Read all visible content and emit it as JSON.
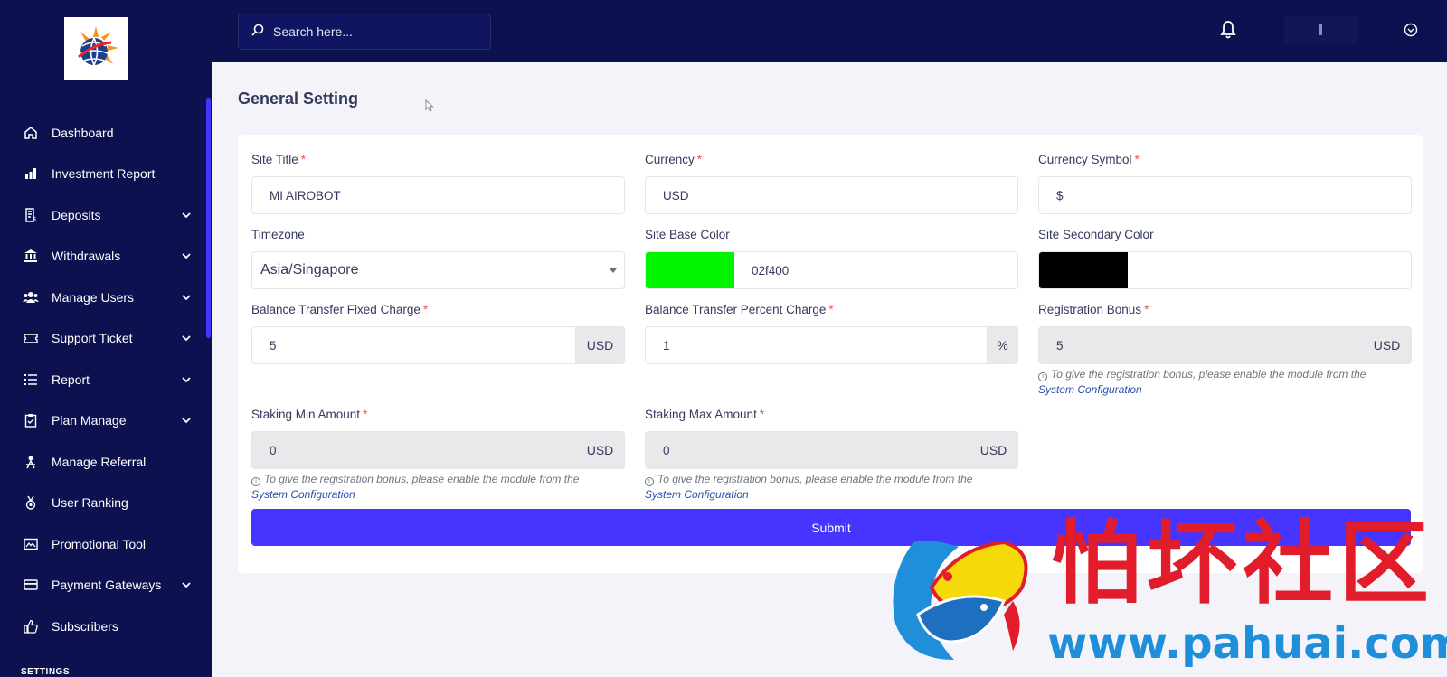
{
  "colors": {
    "sidebar_bg": "#0d1150",
    "accent": "#4634ff",
    "required": "#ea5455",
    "site_base_color": "#02f400",
    "site_secondary_color": "#000000"
  },
  "search": {
    "placeholder": "Search here...",
    "icon": "search-icon"
  },
  "sidebar": {
    "items": [
      {
        "label": "Dashboard",
        "icon": "home-icon",
        "has_submenu": false
      },
      {
        "label": "Investment Report",
        "icon": "bar-chart-icon",
        "has_submenu": false
      },
      {
        "label": "Deposits",
        "icon": "receipt-icon",
        "has_submenu": true
      },
      {
        "label": "Withdrawals",
        "icon": "bank-icon",
        "has_submenu": true
      },
      {
        "label": "Manage Users",
        "icon": "users-icon",
        "has_submenu": true
      },
      {
        "label": "Support Ticket",
        "icon": "ticket-icon",
        "has_submenu": true
      },
      {
        "label": "Report",
        "icon": "list-icon",
        "has_submenu": true
      },
      {
        "label": "Plan Manage",
        "icon": "clipboard-icon",
        "has_submenu": true
      },
      {
        "label": "Manage Referral",
        "icon": "referral-icon",
        "has_submenu": false
      },
      {
        "label": "User Ranking",
        "icon": "medal-icon",
        "has_submenu": false
      },
      {
        "label": "Promotional Tool",
        "icon": "image-icon",
        "has_submenu": false
      },
      {
        "label": "Payment Gateways",
        "icon": "credit-card-icon",
        "has_submenu": true
      },
      {
        "label": "Subscribers",
        "icon": "thumbs-up-icon",
        "has_submenu": false
      }
    ],
    "section_label": "SETTINGS"
  },
  "page": {
    "title": "General Setting"
  },
  "form": {
    "site_title": {
      "label": "Site Title",
      "required": "*",
      "value": "MI AIROBOT"
    },
    "currency": {
      "label": "Currency",
      "required": "*",
      "value": "USD"
    },
    "currency_symbol": {
      "label": "Currency Symbol",
      "required": "*",
      "value": "$"
    },
    "timezone": {
      "label": "Timezone",
      "value": "Asia/Singapore"
    },
    "site_base_color": {
      "label": "Site Base Color",
      "value": "02f400"
    },
    "site_secondary_color": {
      "label": "Site Secondary Color",
      "value": ""
    },
    "bt_fixed_charge": {
      "label": "Balance Transfer Fixed Charge",
      "required": "*",
      "value": "5",
      "addon": "USD"
    },
    "bt_percent_charge": {
      "label": "Balance Transfer Percent Charge",
      "required": "*",
      "value": "1",
      "addon": "%"
    },
    "registration_bonus": {
      "label": "Registration Bonus",
      "required": "*",
      "value": "5",
      "addon": "USD",
      "hint": "To give the registration bonus, please enable the module from the",
      "hint_link": "System Configuration"
    },
    "staking_min": {
      "label": "Staking Min Amount",
      "required": "*",
      "value": "0",
      "addon": "USD",
      "hint": "To give the registration bonus, please enable the module from the",
      "hint_link": "System Configuration"
    },
    "staking_max": {
      "label": "Staking Max Amount",
      "required": "*",
      "value": "0",
      "addon": "USD",
      "hint": "To give the registration bonus, please enable the module from the",
      "hint_link": "System Configuration"
    },
    "submit_label": "Submit"
  },
  "watermark": {
    "cn": "怕坏社区",
    "url": "www.pahuai.com"
  }
}
